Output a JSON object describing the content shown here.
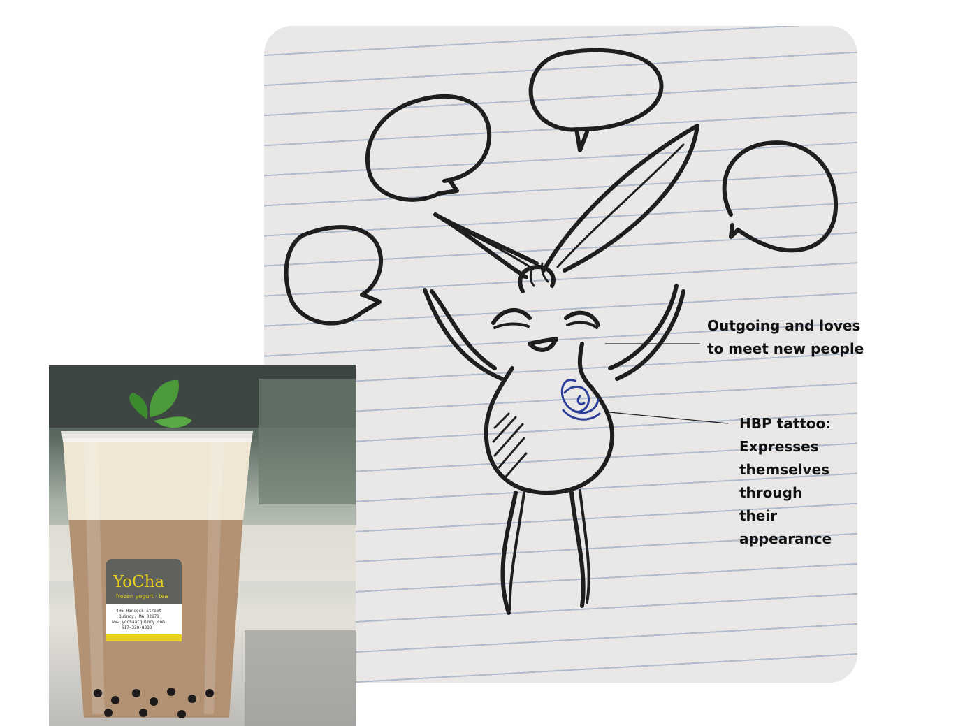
{
  "annotations": {
    "outgoing": [
      "Outgoing and loves",
      "to meet new people"
    ],
    "tattoo": [
      "HBP tattoo:",
      "Expresses",
      "themselves",
      "through",
      "their",
      "appearance"
    ]
  },
  "cup_label": {
    "brand": "YoCha",
    "subtitle": "frozen yogurt · tea",
    "address_lines": [
      "406 Hancock Street",
      "Quincy, MA 02171",
      "www.yochaatquincy.com",
      "617-328-8888"
    ]
  },
  "colors": {
    "paper": "#eae8e6",
    "rule_line": "#8096ba",
    "ink": "#1e1e1e",
    "tattoo_ink": "#2b3e9a",
    "label_bg": "#5f625c",
    "label_text": "#e8d21c",
    "tea": "#b39274",
    "foam": "#efe6d3"
  },
  "icons": [
    "speech-bubble-icon",
    "bunny-character-illustration",
    "hbp-tattoo-icon",
    "mint-leaf-icon"
  ]
}
